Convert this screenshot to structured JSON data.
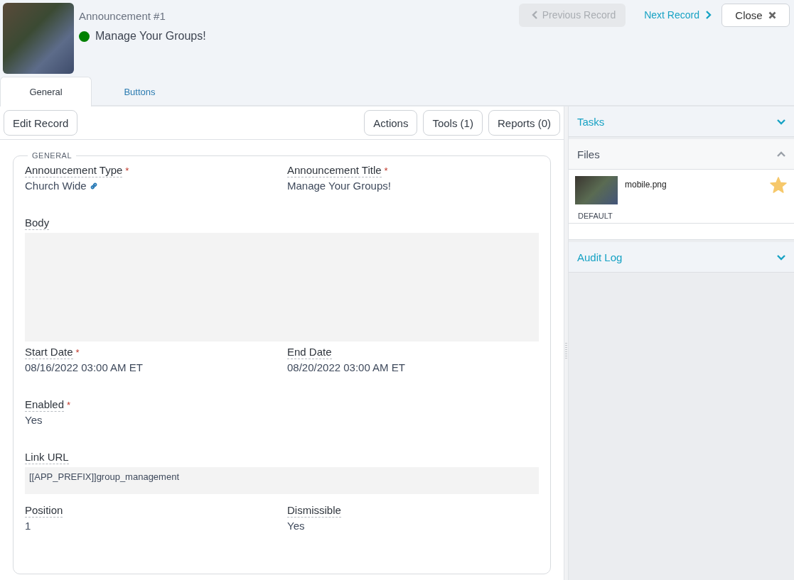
{
  "record": {
    "number": "Announcement #1",
    "title": "Manage Your Groups!",
    "color": "#008000"
  },
  "nav": {
    "previous": {
      "label": "Previous Record",
      "disabled": true
    },
    "next": {
      "label": "Next Record",
      "disabled": false
    },
    "close": "Close"
  },
  "tabs": [
    {
      "label": "General",
      "selected": true
    },
    {
      "label": "Buttons",
      "selected": false
    }
  ],
  "toolbar": {
    "left": [
      "Edit Record"
    ],
    "right": [
      "Actions",
      "Tools (1)",
      "Reports (0)"
    ]
  },
  "section": {
    "legend": "GENERAL",
    "rows": [
      [
        {
          "label": "Announcement Type",
          "required_mark": "*",
          "kind": "link",
          "value": "Church Wide"
        },
        {
          "label": "Announcement Title",
          "required_mark": "*",
          "kind": "text",
          "value": "Manage Your Groups!"
        }
      ],
      [
        {
          "label": "Body",
          "kind": "block"
        }
      ],
      [
        {
          "label": "Start Date",
          "required_mark": "*",
          "kind": "text",
          "value": "08/16/2022 03:00 AM ET"
        },
        {
          "label": "End Date",
          "kind": "text",
          "value": "08/20/2022 03:00 AM ET"
        }
      ],
      [
        {
          "label": "Enabled",
          "required_mark": "*",
          "kind": "text",
          "value": "Yes"
        }
      ],
      [
        {
          "label": "Link URL",
          "kind": "block",
          "value": "[[APP_PREFIX]]group_management"
        }
      ],
      [
        {
          "label": "Position",
          "kind": "text",
          "value": "1"
        },
        {
          "label": "Dismissible",
          "kind": "text",
          "value": "Yes"
        }
      ]
    ]
  },
  "sidebar": [
    {
      "title": "Tasks",
      "expanded": false
    },
    {
      "title": "Files",
      "expanded": true,
      "files": [
        {
          "name": "mobile.png",
          "starred": true,
          "tag": "DEFAULT"
        }
      ]
    },
    {
      "title": "Audit Log",
      "expanded": false
    }
  ]
}
